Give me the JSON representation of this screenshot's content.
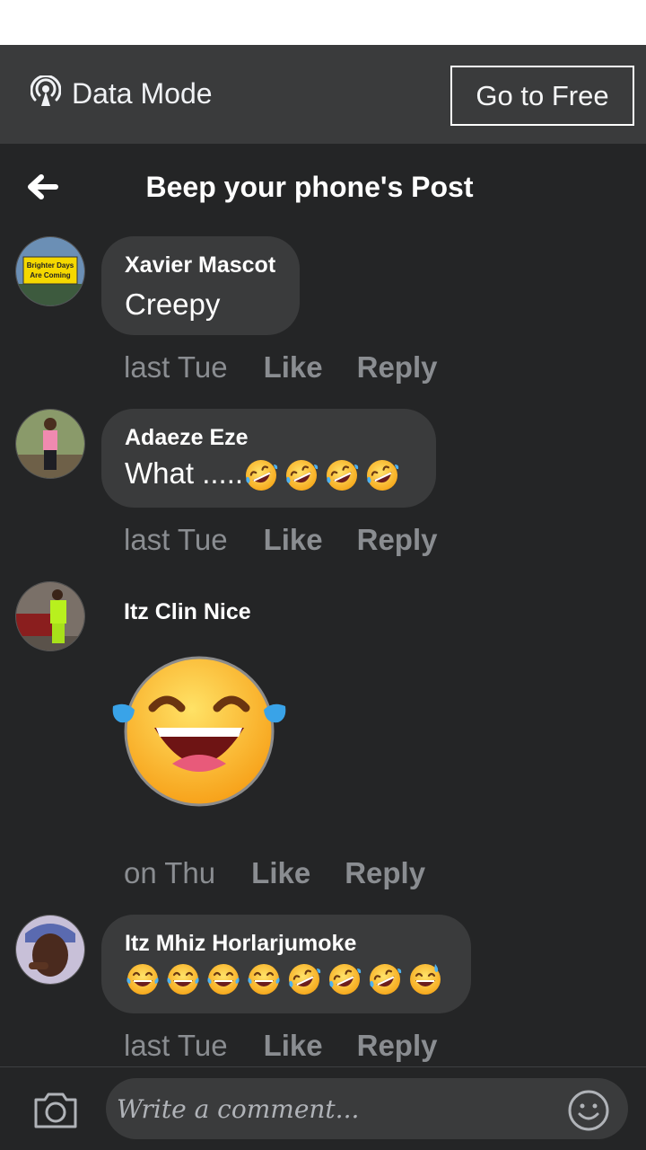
{
  "data_bar": {
    "mode_label": "Data Mode",
    "go_free_label": "Go to Free"
  },
  "header": {
    "title": "Beep your phone's Post"
  },
  "comments": [
    {
      "author": "Xavier Mascot",
      "text": "Creepy",
      "time": "last Tue",
      "like": "Like",
      "reply": "Reply",
      "avatar_sign_text": [
        "Brighter Days",
        "Are Coming"
      ]
    },
    {
      "author": "Adaeze Eze",
      "text": "What  .....",
      "emojis": [
        "rofl-emoji",
        "rofl-emoji",
        "rofl-emoji",
        "rofl-emoji"
      ],
      "time": "last Tue",
      "like": "Like",
      "reply": "Reply"
    },
    {
      "author": "Itz Clin Nice",
      "sticker": "laughing-tears-emoji",
      "time": "on Thu",
      "like": "Like",
      "reply": "Reply"
    },
    {
      "author": "Itz Mhiz Horlarjumoke",
      "emojis": [
        "joy-emoji",
        "joy-emoji",
        "joy-emoji",
        "joy-emoji",
        "rofl-emoji",
        "rofl-emoji",
        "rofl-emoji",
        "sweat-smile-emoji"
      ],
      "time": "last Tue",
      "like": "Like",
      "reply": "Reply"
    }
  ],
  "composer": {
    "placeholder": "Write a comment..."
  },
  "colors": {
    "background": "#242526",
    "bubble": "#3a3b3c",
    "data_bar": "#3a3b3c",
    "meta_text": "#8a8d91"
  }
}
